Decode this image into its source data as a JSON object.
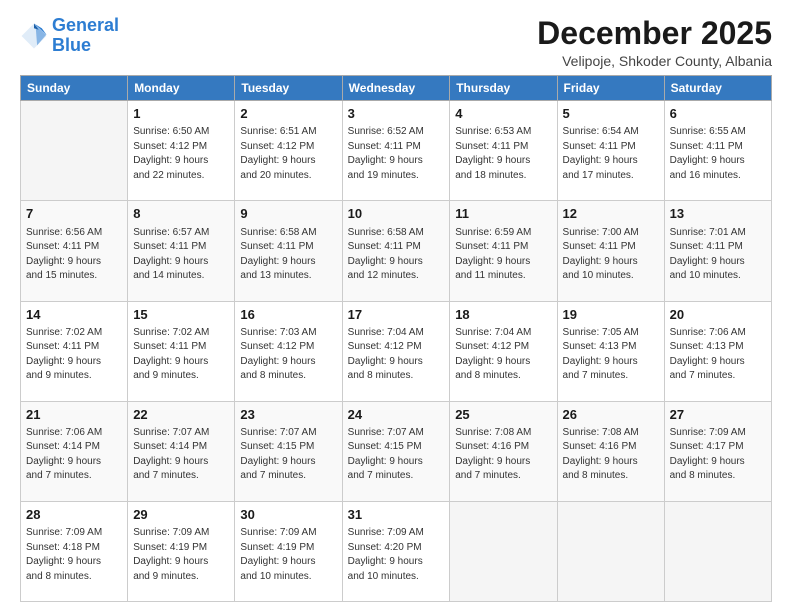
{
  "header": {
    "logo_line1": "General",
    "logo_line2": "Blue",
    "month": "December 2025",
    "location": "Velipoje, Shkoder County, Albania"
  },
  "weekdays": [
    "Sunday",
    "Monday",
    "Tuesday",
    "Wednesday",
    "Thursday",
    "Friday",
    "Saturday"
  ],
  "weeks": [
    [
      {
        "day": "",
        "info": ""
      },
      {
        "day": "1",
        "info": "Sunrise: 6:50 AM\nSunset: 4:12 PM\nDaylight: 9 hours\nand 22 minutes."
      },
      {
        "day": "2",
        "info": "Sunrise: 6:51 AM\nSunset: 4:12 PM\nDaylight: 9 hours\nand 20 minutes."
      },
      {
        "day": "3",
        "info": "Sunrise: 6:52 AM\nSunset: 4:11 PM\nDaylight: 9 hours\nand 19 minutes."
      },
      {
        "day": "4",
        "info": "Sunrise: 6:53 AM\nSunset: 4:11 PM\nDaylight: 9 hours\nand 18 minutes."
      },
      {
        "day": "5",
        "info": "Sunrise: 6:54 AM\nSunset: 4:11 PM\nDaylight: 9 hours\nand 17 minutes."
      },
      {
        "day": "6",
        "info": "Sunrise: 6:55 AM\nSunset: 4:11 PM\nDaylight: 9 hours\nand 16 minutes."
      }
    ],
    [
      {
        "day": "7",
        "info": "Sunrise: 6:56 AM\nSunset: 4:11 PM\nDaylight: 9 hours\nand 15 minutes."
      },
      {
        "day": "8",
        "info": "Sunrise: 6:57 AM\nSunset: 4:11 PM\nDaylight: 9 hours\nand 14 minutes."
      },
      {
        "day": "9",
        "info": "Sunrise: 6:58 AM\nSunset: 4:11 PM\nDaylight: 9 hours\nand 13 minutes."
      },
      {
        "day": "10",
        "info": "Sunrise: 6:58 AM\nSunset: 4:11 PM\nDaylight: 9 hours\nand 12 minutes."
      },
      {
        "day": "11",
        "info": "Sunrise: 6:59 AM\nSunset: 4:11 PM\nDaylight: 9 hours\nand 11 minutes."
      },
      {
        "day": "12",
        "info": "Sunrise: 7:00 AM\nSunset: 4:11 PM\nDaylight: 9 hours\nand 10 minutes."
      },
      {
        "day": "13",
        "info": "Sunrise: 7:01 AM\nSunset: 4:11 PM\nDaylight: 9 hours\nand 10 minutes."
      }
    ],
    [
      {
        "day": "14",
        "info": "Sunrise: 7:02 AM\nSunset: 4:11 PM\nDaylight: 9 hours\nand 9 minutes."
      },
      {
        "day": "15",
        "info": "Sunrise: 7:02 AM\nSunset: 4:11 PM\nDaylight: 9 hours\nand 9 minutes."
      },
      {
        "day": "16",
        "info": "Sunrise: 7:03 AM\nSunset: 4:12 PM\nDaylight: 9 hours\nand 8 minutes."
      },
      {
        "day": "17",
        "info": "Sunrise: 7:04 AM\nSunset: 4:12 PM\nDaylight: 9 hours\nand 8 minutes."
      },
      {
        "day": "18",
        "info": "Sunrise: 7:04 AM\nSunset: 4:12 PM\nDaylight: 9 hours\nand 8 minutes."
      },
      {
        "day": "19",
        "info": "Sunrise: 7:05 AM\nSunset: 4:13 PM\nDaylight: 9 hours\nand 7 minutes."
      },
      {
        "day": "20",
        "info": "Sunrise: 7:06 AM\nSunset: 4:13 PM\nDaylight: 9 hours\nand 7 minutes."
      }
    ],
    [
      {
        "day": "21",
        "info": "Sunrise: 7:06 AM\nSunset: 4:14 PM\nDaylight: 9 hours\nand 7 minutes."
      },
      {
        "day": "22",
        "info": "Sunrise: 7:07 AM\nSunset: 4:14 PM\nDaylight: 9 hours\nand 7 minutes."
      },
      {
        "day": "23",
        "info": "Sunrise: 7:07 AM\nSunset: 4:15 PM\nDaylight: 9 hours\nand 7 minutes."
      },
      {
        "day": "24",
        "info": "Sunrise: 7:07 AM\nSunset: 4:15 PM\nDaylight: 9 hours\nand 7 minutes."
      },
      {
        "day": "25",
        "info": "Sunrise: 7:08 AM\nSunset: 4:16 PM\nDaylight: 9 hours\nand 7 minutes."
      },
      {
        "day": "26",
        "info": "Sunrise: 7:08 AM\nSunset: 4:16 PM\nDaylight: 9 hours\nand 8 minutes."
      },
      {
        "day": "27",
        "info": "Sunrise: 7:09 AM\nSunset: 4:17 PM\nDaylight: 9 hours\nand 8 minutes."
      }
    ],
    [
      {
        "day": "28",
        "info": "Sunrise: 7:09 AM\nSunset: 4:18 PM\nDaylight: 9 hours\nand 8 minutes."
      },
      {
        "day": "29",
        "info": "Sunrise: 7:09 AM\nSunset: 4:19 PM\nDaylight: 9 hours\nand 9 minutes."
      },
      {
        "day": "30",
        "info": "Sunrise: 7:09 AM\nSunset: 4:19 PM\nDaylight: 9 hours\nand 10 minutes."
      },
      {
        "day": "31",
        "info": "Sunrise: 7:09 AM\nSunset: 4:20 PM\nDaylight: 9 hours\nand 10 minutes."
      },
      {
        "day": "",
        "info": ""
      },
      {
        "day": "",
        "info": ""
      },
      {
        "day": "",
        "info": ""
      }
    ]
  ]
}
